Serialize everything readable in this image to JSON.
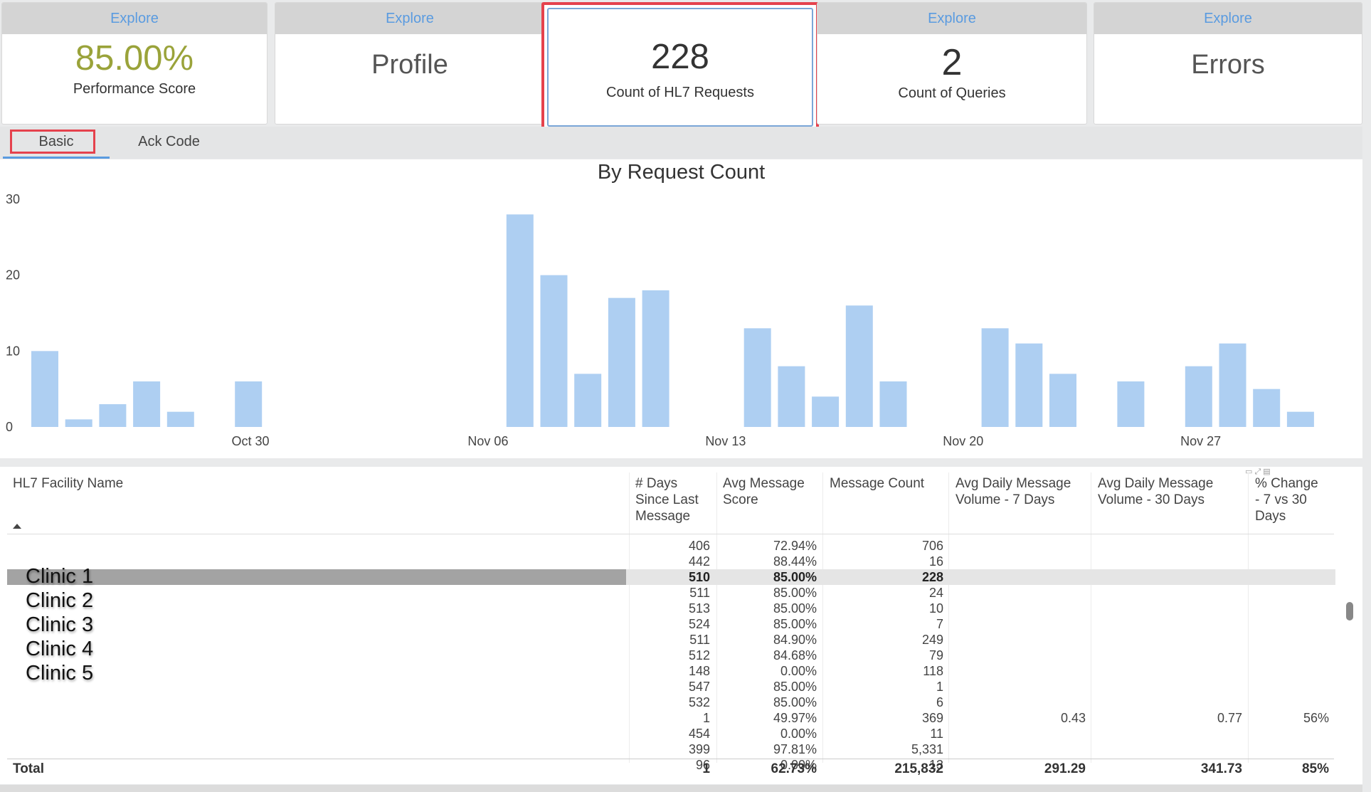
{
  "kpis": {
    "perf": {
      "header": "Explore",
      "value": "85.00%",
      "label": "Performance Score",
      "value_color": "#9aa33a"
    },
    "profile": {
      "header": "Explore",
      "value": "Profile"
    },
    "hl7": {
      "value": "228",
      "label": "Count of HL7 Requests"
    },
    "queries": {
      "header": "Explore",
      "value": "2",
      "label": "Count of Queries"
    },
    "errors": {
      "header": "Explore",
      "value": "Errors"
    }
  },
  "tabs": {
    "basic": "Basic",
    "ack": "Ack Code"
  },
  "chart_data": {
    "type": "bar",
    "title": "By Request Count",
    "ylim": [
      0,
      30
    ],
    "yticks": [
      0,
      10,
      20,
      30
    ],
    "xtick_labels": [
      "Oct 30",
      "Nov 06",
      "Nov 13",
      "Nov 20",
      "Nov 27"
    ],
    "xtick_index": [
      6.5,
      13.5,
      20.5,
      27.5,
      34.5
    ],
    "values": [
      10,
      1,
      3,
      6,
      2,
      0,
      6,
      0,
      0,
      0,
      0,
      0,
      0,
      0,
      28,
      20,
      7,
      17,
      18,
      0,
      0,
      13,
      8,
      4,
      16,
      6,
      0,
      0,
      13,
      11,
      7,
      0,
      6,
      0,
      8,
      11,
      5,
      2
    ],
    "bar_color": "#aecff2",
    "grid": false
  },
  "table": {
    "headers": {
      "facility": "HL7 Facility Name",
      "days": [
        "# Days",
        "Since Last",
        "Message"
      ],
      "score": [
        "Avg Message",
        "Score"
      ],
      "count": [
        "Message Count"
      ],
      "d7": [
        "Avg Daily Message",
        "Volume - 7 Days"
      ],
      "d30": [
        "Avg Daily Message",
        "Volume - 30 Days"
      ],
      "pct": [
        "% Change",
        "- 7 vs 30",
        "Days"
      ]
    },
    "clinics": [
      "Clinic 1",
      "Clinic 2",
      "Clinic 3",
      "Clinic 4",
      "Clinic 5"
    ],
    "rows": [
      {
        "days": "406",
        "score": "72.94%",
        "count": "706",
        "d7": "",
        "d30": "",
        "pct": ""
      },
      {
        "days": "442",
        "score": "88.44%",
        "count": "16",
        "d7": "",
        "d30": "",
        "pct": ""
      },
      {
        "days": "510",
        "score": "85.00%",
        "count": "228",
        "d7": "",
        "d30": "",
        "pct": ""
      },
      {
        "days": "511",
        "score": "85.00%",
        "count": "24",
        "d7": "",
        "d30": "",
        "pct": ""
      },
      {
        "days": "513",
        "score": "85.00%",
        "count": "10",
        "d7": "",
        "d30": "",
        "pct": ""
      },
      {
        "days": "524",
        "score": "85.00%",
        "count": "7",
        "d7": "",
        "d30": "",
        "pct": ""
      },
      {
        "days": "511",
        "score": "84.90%",
        "count": "249",
        "d7": "",
        "d30": "",
        "pct": ""
      },
      {
        "days": "512",
        "score": "84.68%",
        "count": "79",
        "d7": "",
        "d30": "",
        "pct": ""
      },
      {
        "days": "148",
        "score": "0.00%",
        "count": "118",
        "d7": "",
        "d30": "",
        "pct": ""
      },
      {
        "days": "547",
        "score": "85.00%",
        "count": "1",
        "d7": "",
        "d30": "",
        "pct": ""
      },
      {
        "days": "532",
        "score": "85.00%",
        "count": "6",
        "d7": "",
        "d30": "",
        "pct": ""
      },
      {
        "days": "1",
        "score": "49.97%",
        "count": "369",
        "d7": "0.43",
        "d30": "0.77",
        "pct": "56%"
      },
      {
        "days": "454",
        "score": "0.00%",
        "count": "11",
        "d7": "",
        "d30": "",
        "pct": ""
      },
      {
        "days": "399",
        "score": "97.81%",
        "count": "5,331",
        "d7": "",
        "d30": "",
        "pct": ""
      },
      {
        "days": "96",
        "score": "0.00%",
        "count": "13",
        "d7": "",
        "d30": "",
        "pct": ""
      }
    ],
    "total": {
      "label": "Total",
      "days": "1",
      "score": "62.73%",
      "count": "215,832",
      "d7": "291.29",
      "d30": "341.73",
      "pct": "85%"
    }
  }
}
